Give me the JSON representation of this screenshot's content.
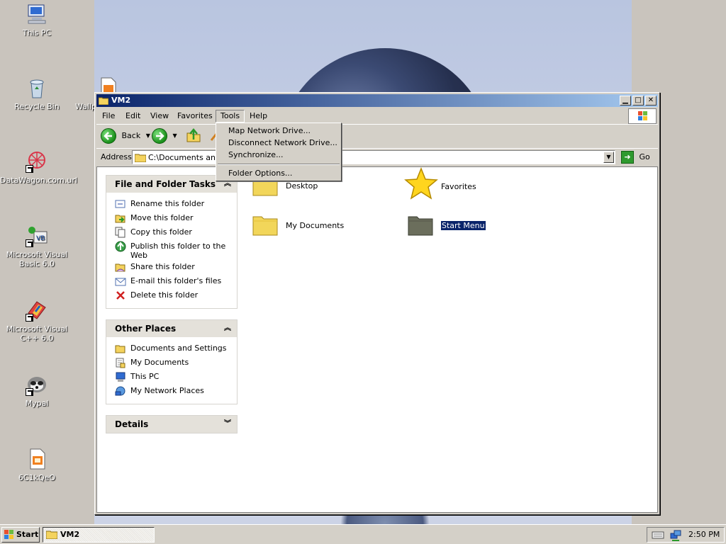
{
  "desktop": {
    "icons": [
      {
        "label": "This PC",
        "icon": "computer-icon"
      },
      {
        "label": "Recycle Bin",
        "icon": "recycle-bin-icon"
      },
      {
        "label": "DataWagon.com.url",
        "icon": "datawagon-icon"
      },
      {
        "label": "Microsoft Visual Basic 6.0",
        "icon": "visual-basic-icon"
      },
      {
        "label": "Microsoft Visual C++ 6.0",
        "icon": "visual-cpp-icon"
      },
      {
        "label": "Mypal",
        "icon": "mypal-icon"
      },
      {
        "label": "6C1kQeO",
        "icon": "file-icon"
      },
      {
        "label": "Wallp",
        "icon": "wallpaper-file-icon"
      }
    ]
  },
  "window": {
    "title": "VM2",
    "menu": [
      "File",
      "Edit",
      "View",
      "Favorites",
      "Tools",
      "Help"
    ],
    "toolbar": {
      "back_label": "Back"
    },
    "address": {
      "label": "Address",
      "value": "C:\\Documents and S",
      "go_label": "Go"
    },
    "tools_menu": [
      "Map Network Drive...",
      "Disconnect Network Drive...",
      "Synchronize...",
      "Folder Options..."
    ],
    "panels": {
      "file_tasks": {
        "title": "File and Folder Tasks",
        "items": [
          "Rename this folder",
          "Move this folder",
          "Copy this folder",
          "Publish this folder to the Web",
          "Share this folder",
          "E-mail this folder's files",
          "Delete this folder"
        ]
      },
      "other_places": {
        "title": "Other Places",
        "items": [
          "Documents and Settings",
          "My Documents",
          "This PC",
          "My Network Places"
        ]
      },
      "details": {
        "title": "Details"
      }
    },
    "folders": [
      {
        "label": "Desktop",
        "icon": "folder-icon"
      },
      {
        "label": "Favorites",
        "icon": "star-icon"
      },
      {
        "label": "My Documents",
        "icon": "folder-icon"
      },
      {
        "label": "Start Menu",
        "icon": "folder-icon",
        "selected": true
      }
    ]
  },
  "taskbar": {
    "start_label": "Start",
    "tasks": [
      "VM2"
    ],
    "clock": "2:50 PM"
  },
  "colors": {
    "titlebar": "#0a246a",
    "selection": "#0a246a",
    "face": "#d4d0c8"
  }
}
